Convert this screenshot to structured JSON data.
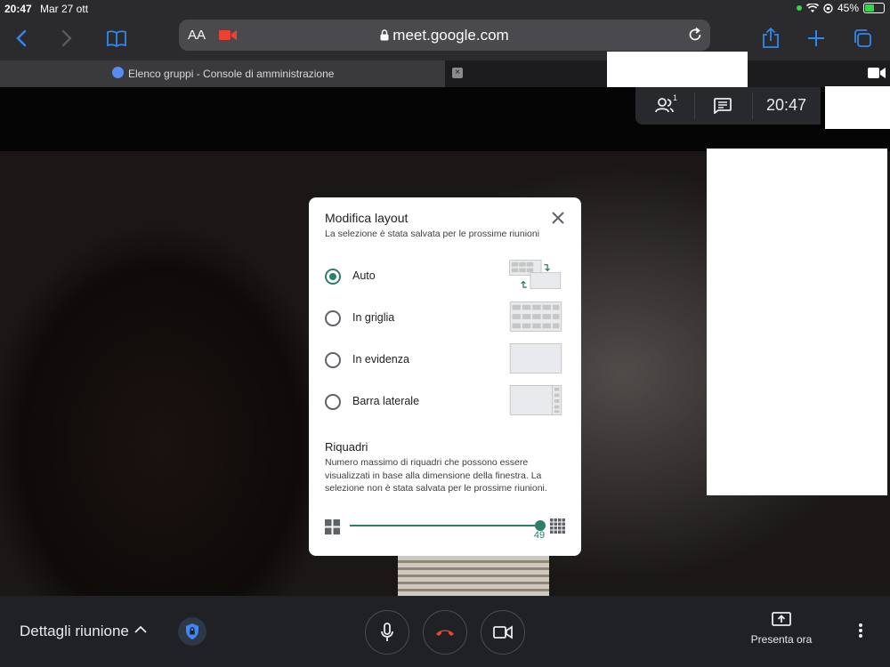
{
  "status": {
    "time": "20:47",
    "date": "Mar 27 ott",
    "battery": "45%"
  },
  "browser": {
    "text_size": "AA",
    "url": "meet.google.com",
    "tab_title": "Elenco gruppi - Console di amministrazione",
    "tab_close": "×"
  },
  "meet": {
    "participants_count": "1",
    "clock": "20:47",
    "details_label": "Dettagli riunione",
    "present_label": "Presenta ora"
  },
  "dialog": {
    "title": "Modifica layout",
    "subtitle": "La selezione è stata salvata per le prossime riunioni",
    "options": [
      {
        "label": "Auto",
        "selected": true
      },
      {
        "label": "In griglia",
        "selected": false
      },
      {
        "label": "In evidenza",
        "selected": false
      },
      {
        "label": "Barra laterale",
        "selected": false
      }
    ],
    "tiles_title": "Riquadri",
    "tiles_desc": "Numero massimo di riquadri che possono essere visualizzati in base alla dimensione della finestra. La selezione non è stata salvata per le prossime riunioni.",
    "tiles_value": "49"
  },
  "colors": {
    "accent": "#2d7f6a",
    "safari_blue": "#2f87f0",
    "hangup_red": "#ea4335"
  }
}
